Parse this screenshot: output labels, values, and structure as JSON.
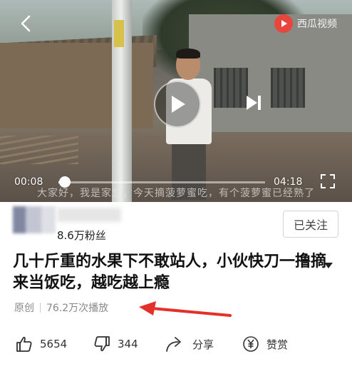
{
  "player": {
    "brand_name": "西瓜视频",
    "current_time": "00:08",
    "total_time": "04:18",
    "progress": 0.031,
    "subtitle": "大家好，我是家立，今天摘菠萝蜜吃，有个菠萝蜜已经熟了"
  },
  "author": {
    "fans": "8.6万粉丝",
    "follow_label": "已关注"
  },
  "video": {
    "title": "几十斤重的水果下不敢站人，小伙快刀一撸摘来当饭吃，越吃越上瘾",
    "original_tag": "原创",
    "plays": "76.2万次播放"
  },
  "actions": {
    "like_count": "5654",
    "dislike_count": "344",
    "share_label": "分享",
    "reward_label": "赞赏"
  },
  "colors": {
    "annotation_arrow": "#e3302a",
    "brand_red": "#e8453c"
  }
}
